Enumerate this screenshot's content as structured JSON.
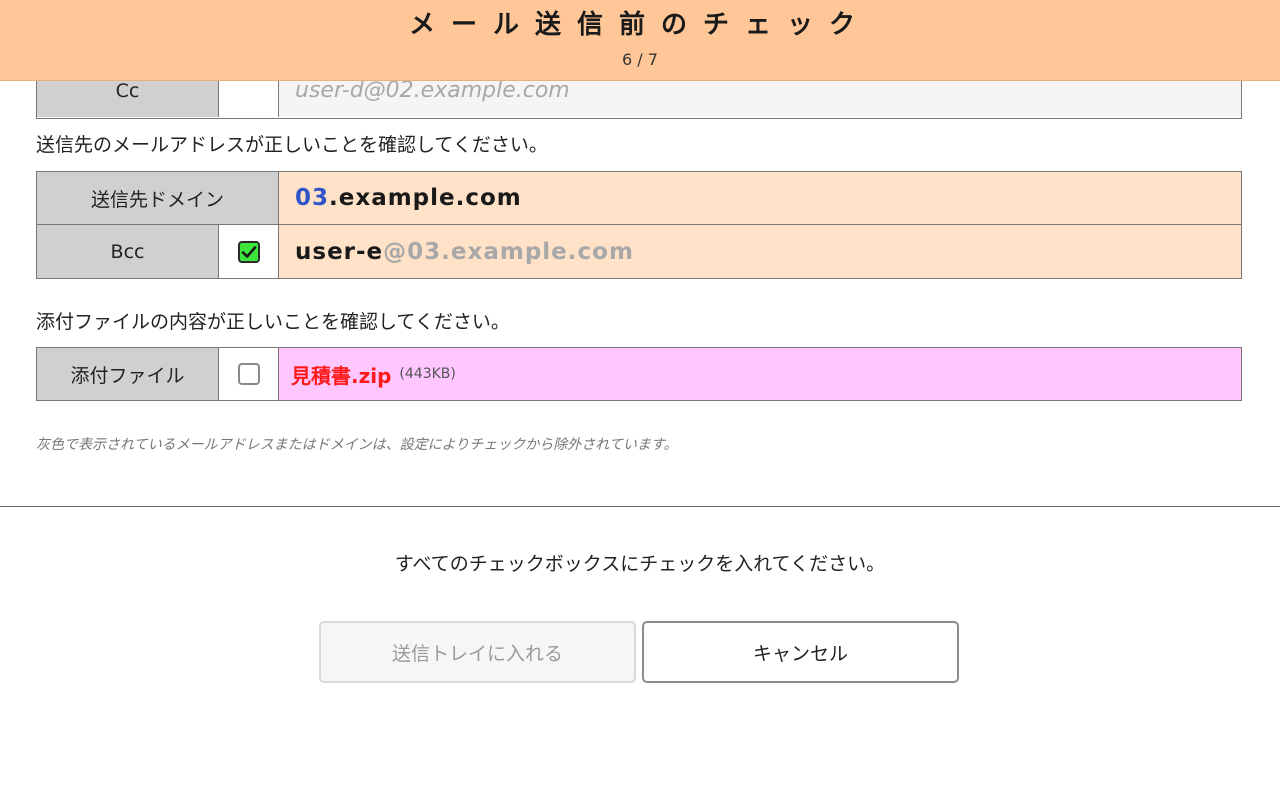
{
  "header": {
    "title": "メール送信前のチェック",
    "page": "6 / 7"
  },
  "cc_row": {
    "label": "Cc",
    "value": "user-d@02.example.com"
  },
  "instruction_address": "送信先のメールアドレスが正しいことを確認してください。",
  "domain_table": {
    "domain_label": "送信先ドメイン",
    "domain_prefix": "03",
    "domain_rest": ".example.com",
    "bcc_label": "Bcc",
    "bcc_checked": true,
    "bcc_user": "user-e",
    "bcc_domain": "@03.example.com"
  },
  "instruction_attachment": "添付ファイルの内容が正しいことを確認してください。",
  "attachment": {
    "label": "添付ファイル",
    "checked": false,
    "filename": "見積書.zip",
    "size": "(443KB)"
  },
  "note": "灰色で表示されているメールアドレスまたはドメインは、設定によりチェックから除外されています。",
  "prompt": "すべてのチェックボックスにチェックを入れてください。",
  "buttons": {
    "send": "送信トレイに入れる",
    "cancel": "キャンセル"
  },
  "colors": {
    "header_bg": "#ffc797",
    "domain_row_bg": "#ffe2c8",
    "attachment_row_bg": "#ffc6ff",
    "cc_value_bg": "#f5f5f5",
    "checked_green": "#3ce63c",
    "domain_prefix_blue": "#2f55c9",
    "filename_red": "#ff1a1a",
    "excluded_gray": "#a8a8a8"
  }
}
